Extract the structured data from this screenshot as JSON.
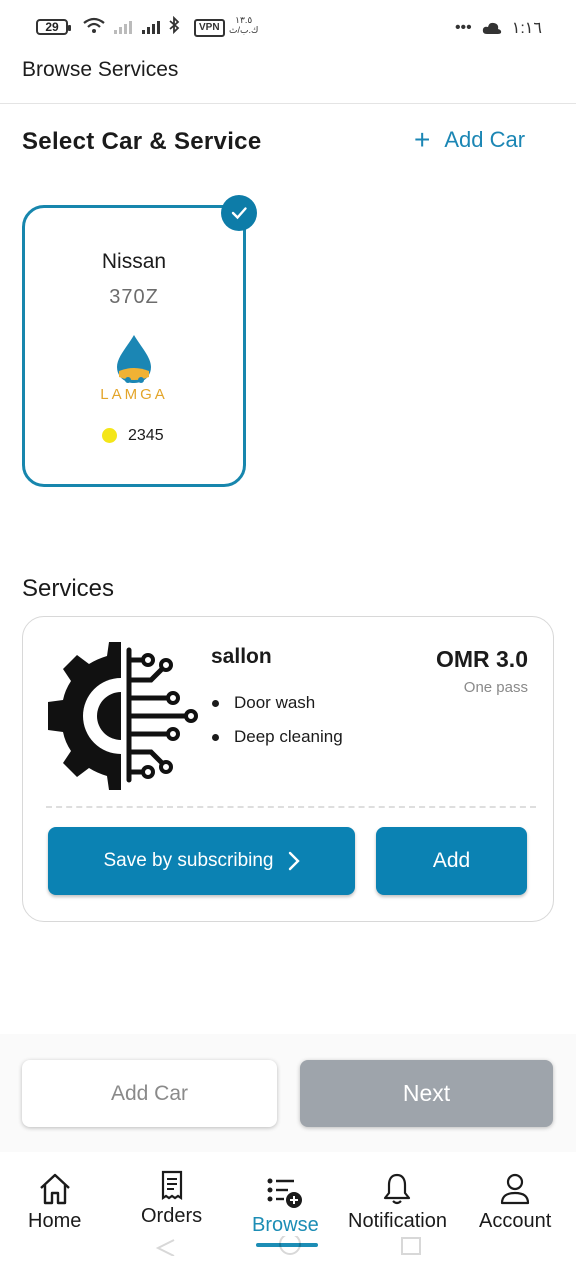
{
  "status_bar": {
    "battery": "29",
    "vpn": "VPN",
    "speed": "١٣.٥",
    "speed_unit": "ك.ب/ث",
    "time": "١:١٦"
  },
  "app": {
    "title": "Browse Services"
  },
  "select_section": {
    "title": "Select Car & Service",
    "add_car_label": "Add Car"
  },
  "car": {
    "make": "Nissan",
    "model": "370Z",
    "logo_text": "LAMGA",
    "plate": "2345",
    "dot_color": "#f4e619",
    "selected": true
  },
  "services": {
    "title": "Services",
    "items": [
      {
        "name": "sallon",
        "price": "OMR 3.0",
        "price_note": "One pass",
        "features": [
          "Door wash",
          "Deep cleaning"
        ],
        "subscribe_label": "Save by subscribing",
        "add_label": "Add"
      }
    ]
  },
  "actions": {
    "add_car": "Add Car",
    "next": "Next"
  },
  "nav": {
    "items": [
      {
        "label": "Home",
        "icon": "home-icon"
      },
      {
        "label": "Orders",
        "icon": "receipt-icon"
      },
      {
        "label": "Browse",
        "icon": "browse-list-icon",
        "active": true
      },
      {
        "label": "Notification",
        "icon": "bell-icon"
      },
      {
        "label": "Account",
        "icon": "user-icon"
      }
    ]
  },
  "colors": {
    "accent": "#0b82b3",
    "next_disabled": "#9ea4ab",
    "card_border": "#1786ad"
  }
}
